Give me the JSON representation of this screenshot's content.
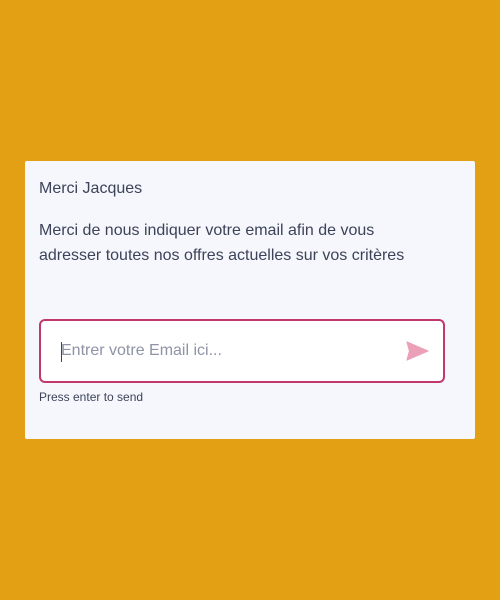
{
  "colors": {
    "background": "#E3A015",
    "card": "#F5F7FC",
    "text": "#3C4358",
    "input_border": "#C2386C",
    "send_icon": "#EBA0B8"
  },
  "chat": {
    "greeting": "Merci Jacques",
    "message": "Merci de nous indiquer votre email afin de vous adresser toutes nos offres actuelles sur vos critères"
  },
  "email_input": {
    "value": "",
    "placeholder": "Entrer votre Email ici..."
  },
  "send_button": {
    "icon": "send-icon"
  },
  "hint": "Press enter to send"
}
